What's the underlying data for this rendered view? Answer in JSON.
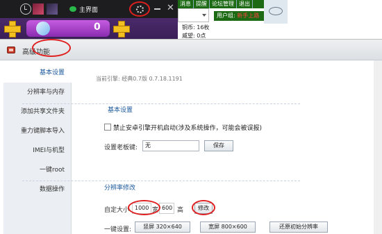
{
  "topbar": {
    "main_label": "主界面"
  },
  "game": {
    "gem_value": "0"
  },
  "site": {
    "nav": [
      "消息",
      "提醒",
      "论坛管理",
      "退出"
    ],
    "usergroup_prefix": "用户组: ",
    "usergroup_value": "新手上路",
    "coins": "铜币: 16枚",
    "coins2": "威望: 0点"
  },
  "dialog": {
    "title": "高级功能",
    "sidebar": [
      "基本设置",
      "分辨率与内存",
      "添加共享文件夹",
      "重力键脚本导入",
      "IMEI与机型",
      "一键root",
      "数据操作"
    ],
    "engine_label": "当前引擎: 经典0.7版 0.7.18.1191",
    "basic": {
      "title": "基本设置",
      "checkbox_label": "禁止安卓引擎开机启动(涉及系统操作，可能会被误报)",
      "boss_key_label": "设置老板键:",
      "boss_key_value": "无",
      "save_label": "保存"
    },
    "resolution": {
      "title": "分辨率修改",
      "custom_label": "自定大小",
      "width_value": "1000",
      "width_unit": "宽",
      "height_value": "600",
      "height_unit": "高",
      "modify_label": "修改",
      "oneclick_label": "一键设置:",
      "portrait_label": "竖屏  320×640",
      "landscape_label": "宽屏  800×600",
      "restore_label": "还原初始分辨率"
    }
  }
}
